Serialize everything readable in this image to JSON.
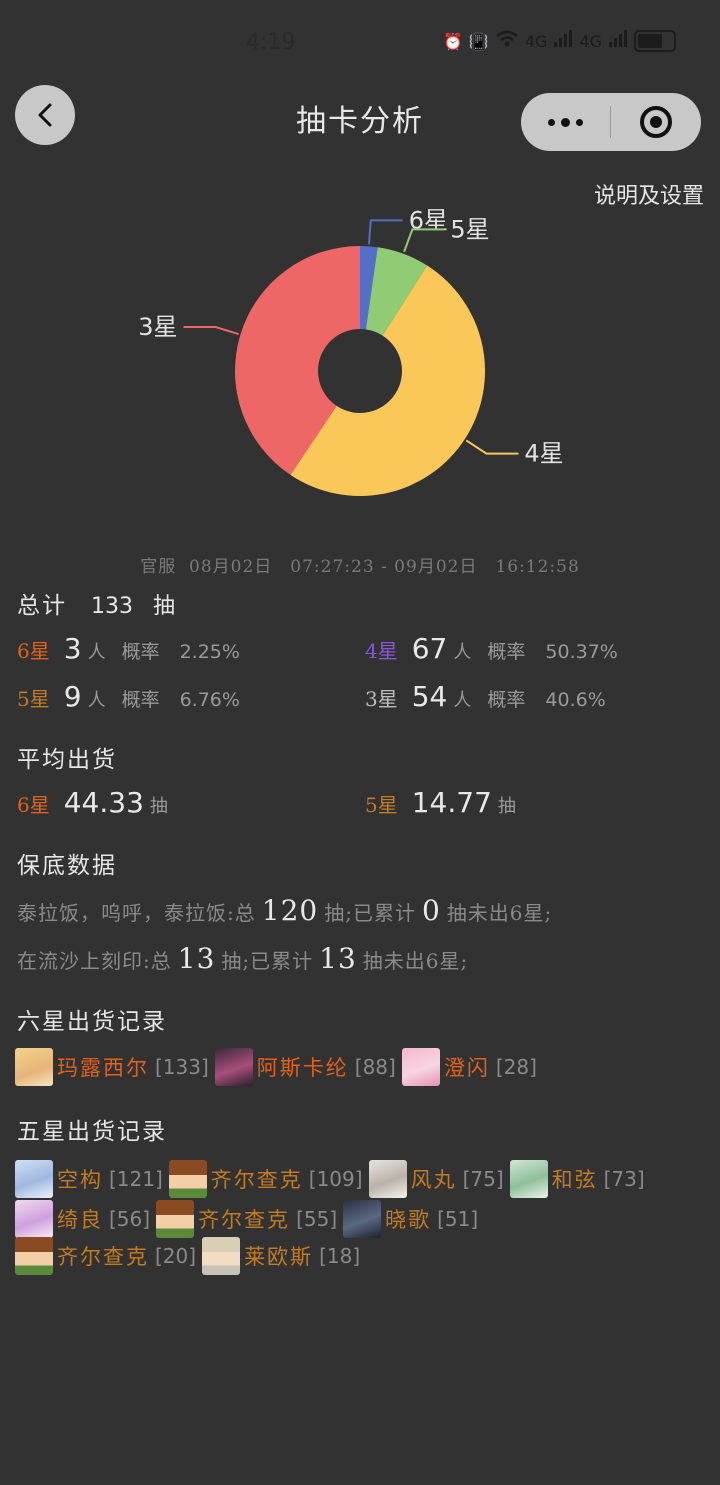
{
  "status_bar": {
    "time": "4:19",
    "signal_1": "4G",
    "signal_2": "4G"
  },
  "nav": {
    "title": "抽卡分析",
    "settings": "说明及设置"
  },
  "chart_data": {
    "type": "pie",
    "title": "",
    "donut": true,
    "slices": [
      {
        "label": "6星",
        "value": 3,
        "color": "#5470c6"
      },
      {
        "label": "5星",
        "value": 9,
        "color": "#91cc75"
      },
      {
        "label": "4星",
        "value": 67,
        "color": "#fac858"
      },
      {
        "label": "3星",
        "value": 54,
        "color": "#ee6666"
      }
    ]
  },
  "summary": {
    "pool": "官服",
    "range": "08月02日　07:27:23 - 09月02日　16:12:58",
    "total_label": "总计",
    "total": "133",
    "total_unit": "抽",
    "rate_label": "概率",
    "person_unit": "人",
    "stats": [
      {
        "star": "6星",
        "count": "3",
        "rate": "2.25%"
      },
      {
        "star": "4星",
        "count": "67",
        "rate": "50.37%"
      },
      {
        "star": "5星",
        "count": "9",
        "rate": "6.76%"
      },
      {
        "star": "3星",
        "count": "54",
        "rate": "40.6%"
      }
    ]
  },
  "average": {
    "title": "平均出货",
    "unit": "抽",
    "items": [
      {
        "star": "6星",
        "value": "44.33"
      },
      {
        "star": "5星",
        "value": "14.77"
      }
    ]
  },
  "pity": {
    "title": "保底数据",
    "rows": [
      {
        "pool": "泰拉饭，呜呼，泰拉饭:总",
        "total": "120",
        "mid": "抽;已累计",
        "count": "0",
        "tail": "抽未出6星;"
      },
      {
        "pool": "在流沙上刻印:总",
        "total": "13",
        "mid": "抽;已累计",
        "count": "13",
        "tail": "抽未出6星;"
      }
    ]
  },
  "six_star_records": {
    "title": "六星出货记录",
    "items": [
      {
        "name": "玛露西尔",
        "pull": "[133]"
      },
      {
        "name": "阿斯卡纶",
        "pull": "[88]"
      },
      {
        "name": "澄闪",
        "pull": "[28]"
      }
    ]
  },
  "five_star_records": {
    "title": "五星出货记录",
    "lines": [
      [
        {
          "name": "空构",
          "pull": "[121]"
        },
        {
          "name": "齐尔查克",
          "pull": "[109]"
        },
        {
          "name": "风丸",
          "pull": "[75]"
        },
        {
          "name": "和弦",
          "pull": "[73]"
        }
      ],
      [
        {
          "name": "绮良",
          "pull": "[56]"
        },
        {
          "name": "齐尔查克",
          "pull": "[55]"
        },
        {
          "name": "晓歌",
          "pull": "[51]"
        }
      ],
      [
        {
          "name": "齐尔查克",
          "pull": "[20]"
        },
        {
          "name": "莱欧斯",
          "pull": "[18]"
        }
      ]
    ]
  }
}
